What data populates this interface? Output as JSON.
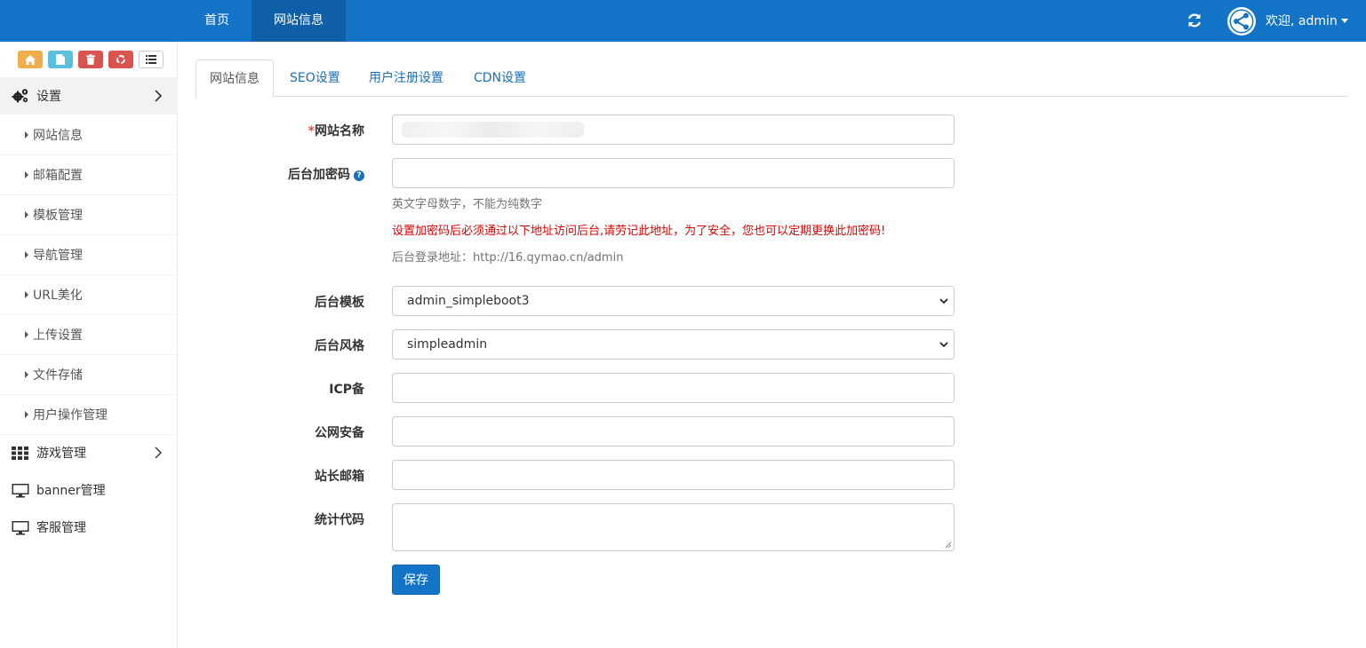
{
  "topnav": {
    "items": [
      {
        "label": "首页"
      },
      {
        "label": "网站信息"
      }
    ],
    "user_label": "欢迎, admin"
  },
  "sidebar": {
    "groups": [
      {
        "label": "设置",
        "icon": "gears-icon"
      },
      {
        "label": "游戏管理",
        "icon": "grid-icon"
      },
      {
        "label": "banner管理",
        "icon": "monitor-icon"
      },
      {
        "label": "客服管理",
        "icon": "monitor-icon"
      }
    ],
    "items": [
      {
        "label": "网站信息"
      },
      {
        "label": "邮箱配置"
      },
      {
        "label": "模板管理"
      },
      {
        "label": "导航管理"
      },
      {
        "label": "URL美化"
      },
      {
        "label": "上传设置"
      },
      {
        "label": "文件存储"
      },
      {
        "label": "用户操作管理"
      }
    ]
  },
  "tabs": [
    {
      "label": "网站信息"
    },
    {
      "label": "SEO设置"
    },
    {
      "label": "用户注册设置"
    },
    {
      "label": "CDN设置"
    }
  ],
  "form": {
    "site_name_req": "*",
    "site_name_label": "网站名称",
    "admin_pwd_label": "后台加密码",
    "admin_pwd_hint": "英文字母数字，不能为纯数字",
    "admin_pwd_warning": "设置加密码后必须通过以下地址访问后台,请劳记此地址，为了安全，您也可以定期更换此加密码!",
    "admin_login_url": "后台登录地址：http://16.qymao.cn/admin",
    "admin_template_label": "后台模板",
    "admin_template_value": "admin_simpleboot3",
    "admin_style_label": "后台风格",
    "admin_style_value": "simpleadmin",
    "icp_label": "ICP备",
    "police_label": "公网安备",
    "email_label": "站长邮箱",
    "stats_label": "统计代码",
    "save_label": "保存"
  },
  "colors": {
    "topbar": "#1373c6",
    "topbar_active": "#0e5fa7",
    "link": "#1a6fb8",
    "warning": "#dd0000"
  }
}
